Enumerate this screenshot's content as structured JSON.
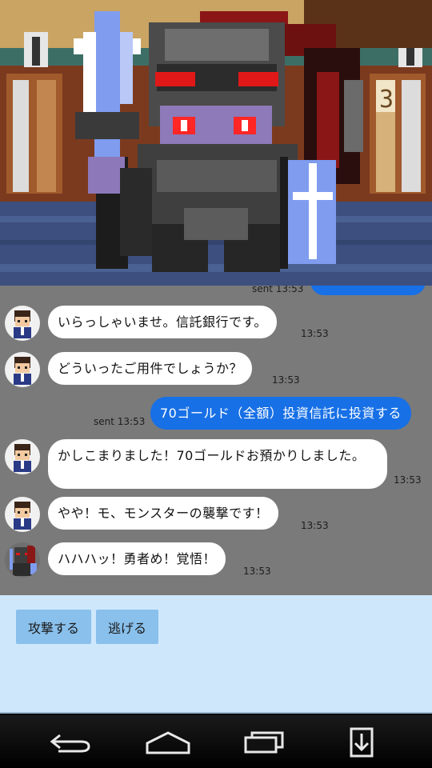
{
  "chat": {
    "partial_sent_label": "sent 13:53",
    "messages": [
      {
        "text": "いらっしゃいませ。信託銀行です。",
        "time": "13:53"
      },
      {
        "text": "どういったご用件でしょうか？",
        "time": "13:53"
      },
      {
        "text": "70ゴールド（全額）投資信託に投資する",
        "time": "sent 13:53"
      },
      {
        "text": "かしこまりました！70ゴールドお預かりしました。",
        "time": "13:53"
      },
      {
        "text": "やや！モ、モンスターの襲撃です！",
        "time": "13:53"
      },
      {
        "text": "ハハハッ！勇者め！覚悟！",
        "time": "13:53"
      }
    ]
  },
  "actions": {
    "attack_label": "攻撃する",
    "flee_label": "逃げる"
  },
  "icons": {
    "back": "back-icon",
    "home": "home-icon",
    "recents": "recents-icon",
    "download": "download-icon"
  },
  "colors": {
    "chat_bg": "#7a7a7a",
    "sent_bubble": "#1770e6",
    "received_bubble": "#ffffff",
    "action_panel": "#cfe7fb",
    "action_button": "#89c0ec"
  }
}
